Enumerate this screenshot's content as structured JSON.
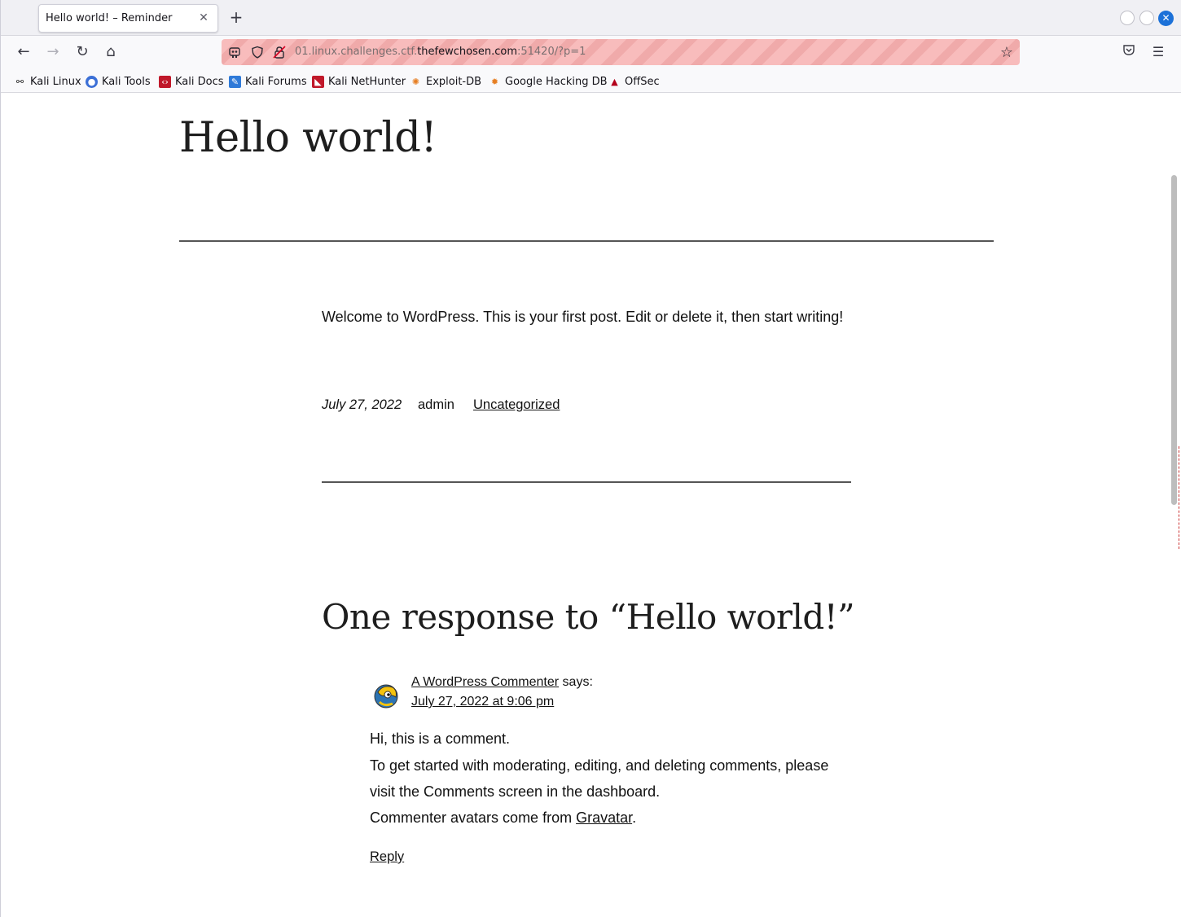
{
  "browser": {
    "tab_title": "Hello world! – Reminder",
    "tab_close": "✕",
    "new_tab": "+",
    "url_prefix": "01.linux.challenges.ctf.",
    "url_host": "thefewchosen.com",
    "url_suffix": ":51420/?p=1",
    "bookmarks": [
      {
        "label": "Kali Linux",
        "icon": "kali-dragon-icon"
      },
      {
        "label": "Kali Tools",
        "icon": "kali-tools-icon"
      },
      {
        "label": "Kali Docs",
        "icon": "kali-docs-icon"
      },
      {
        "label": "Kali Forums",
        "icon": "kali-forums-icon"
      },
      {
        "label": "Kali NetHunter",
        "icon": "nethunter-icon"
      },
      {
        "label": "Exploit-DB",
        "icon": "exploit-db-icon"
      },
      {
        "label": "Google Hacking DB",
        "icon": "ghdb-icon"
      },
      {
        "label": "OffSec",
        "icon": "offsec-icon"
      }
    ]
  },
  "post": {
    "title": "Hello world!",
    "body": "Welcome to WordPress. This is your first post. Edit or delete it, then start writing!",
    "date": "July 27, 2022",
    "author": "admin",
    "category": "Uncategorized"
  },
  "comments": {
    "heading": "One response to “Hello world!”",
    "items": [
      {
        "author": "A WordPress Commenter",
        "says": " says:",
        "date": "July 27, 2022 at 9:06 pm",
        "line1": "Hi, this is a comment.",
        "line2": "To get started with moderating, editing, and deleting comments, please",
        "line3": "visit the Comments screen in the dashboard.",
        "line4_prefix": "Commenter avatars come from ",
        "line4_link": "Gravatar",
        "line4_suffix": ".",
        "reply": "Reply"
      }
    ]
  },
  "colors": {
    "url_bar_stripe_a": "#f8bcbc",
    "url_bar_stripe_b": "#f0aaaa",
    "close_button": "#1c71d8",
    "text": "#111111"
  }
}
